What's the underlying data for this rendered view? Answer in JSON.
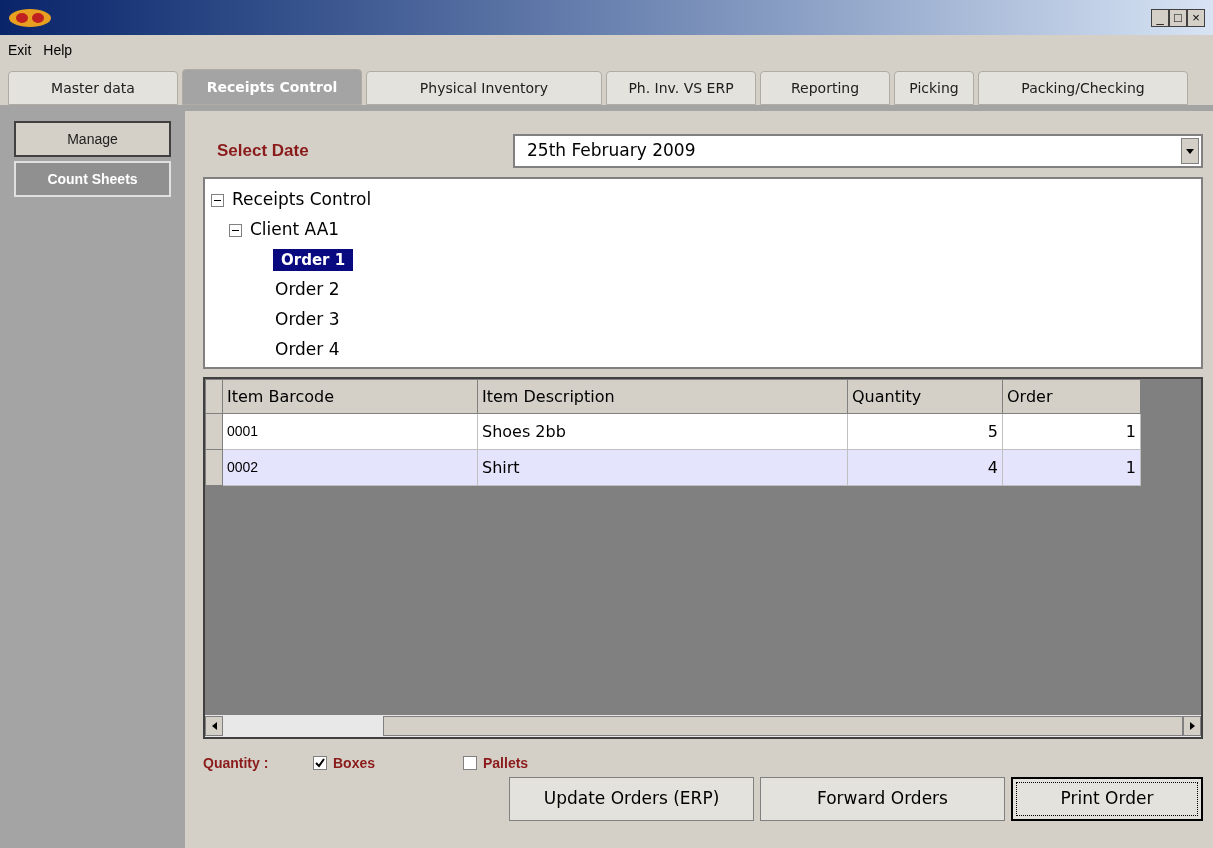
{
  "window": {
    "title_controls": [
      "_",
      "□",
      "×"
    ]
  },
  "menu": [
    "Exit",
    "Help"
  ],
  "tabs": [
    {
      "label": "Master data",
      "selected": false
    },
    {
      "label": "Receipts Control",
      "selected": true
    },
    {
      "label": "Physical Inventory",
      "selected": false
    },
    {
      "label": "Ph. Inv. VS ERP",
      "selected": false
    },
    {
      "label": "Reporting",
      "selected": false
    },
    {
      "label": "Picking",
      "selected": false
    },
    {
      "label": "Packing/Checking",
      "selected": false
    }
  ],
  "sidebar": {
    "items": [
      {
        "label": "Manage",
        "selected": false
      },
      {
        "label": "Count Sheets",
        "selected": true
      }
    ]
  },
  "date": {
    "label": "Select Date",
    "value": "25th February 2009"
  },
  "tree": [
    {
      "label": "Receipts Control",
      "expanded": true,
      "selected": false,
      "children": [
        {
          "label": "Client AA1",
          "expanded": true,
          "selected": false,
          "children": [
            {
              "label": "Order 1",
              "selected": true
            },
            {
              "label": "Order 2",
              "selected": false
            },
            {
              "label": "Order 3",
              "selected": false
            },
            {
              "label": "Order 4",
              "selected": false
            }
          ]
        }
      ]
    }
  ],
  "table": {
    "columns": [
      "Item Barcode",
      "Item Description",
      "Quantity",
      "Order"
    ],
    "rows": [
      {
        "cells": [
          "0001",
          "Shoes 2bb",
          "5",
          "1"
        ],
        "selected": false
      },
      {
        "cells": [
          "0002",
          "Shirt",
          "4",
          "1"
        ],
        "selected": true
      }
    ]
  },
  "quantity": {
    "label": "Quantity :",
    "options": [
      {
        "label": "Boxes",
        "checked": true
      },
      {
        "label": "Pallets",
        "checked": false
      }
    ]
  },
  "buttons": [
    {
      "label": "Update Orders (ERP)",
      "default": false
    },
    {
      "label": "Forward Orders",
      "default": false
    },
    {
      "label": "Print Order",
      "default": true
    }
  ]
}
